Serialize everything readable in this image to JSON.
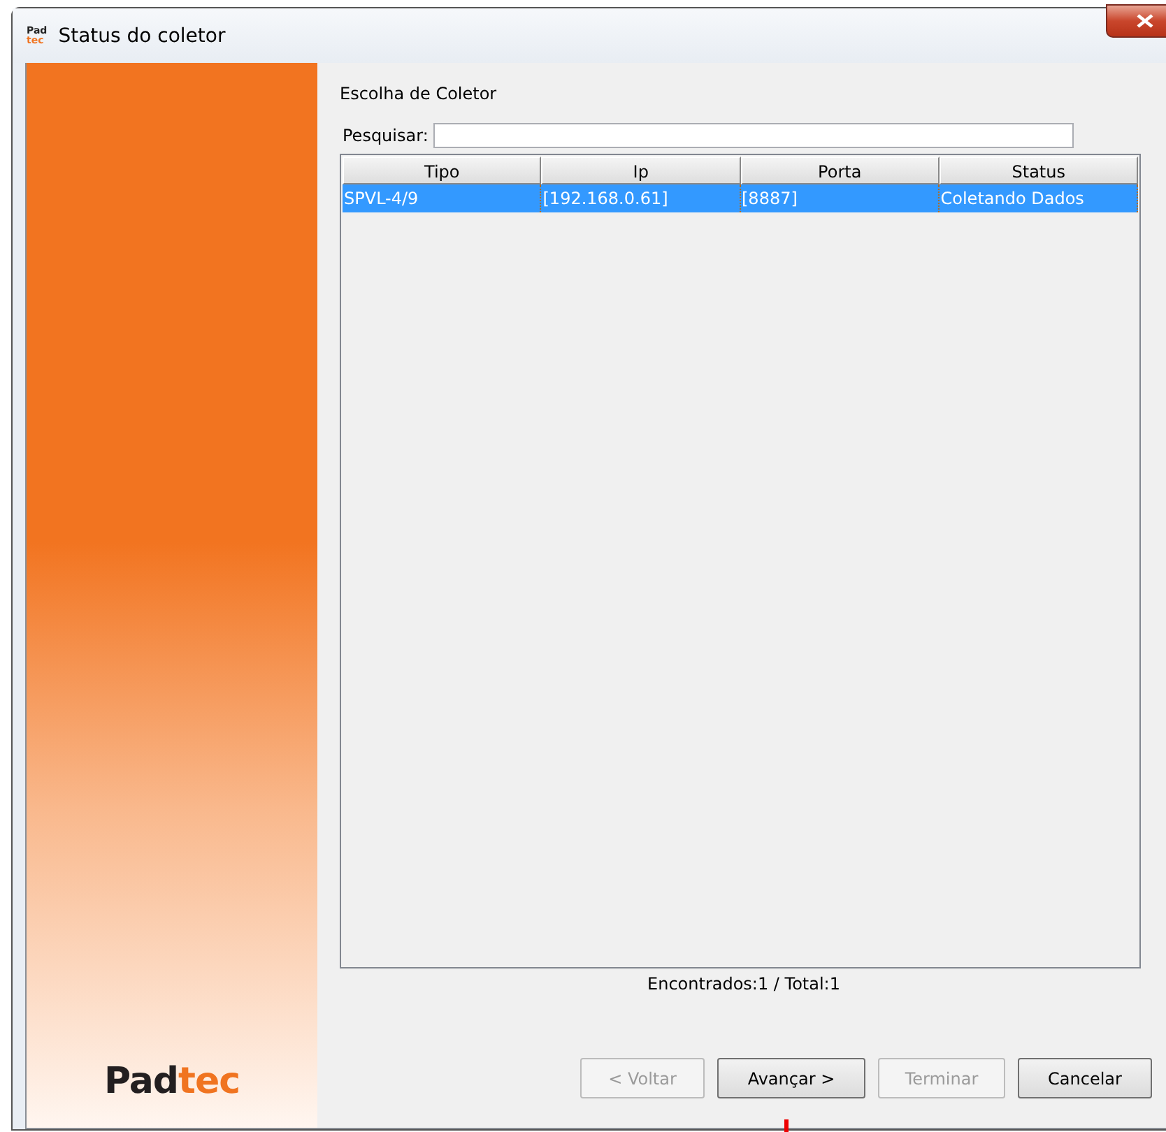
{
  "window": {
    "title": "Status do coletor",
    "icon": [
      "Pad",
      "tec"
    ]
  },
  "logo": [
    "Pad",
    "tec"
  ],
  "heading": "Escolha de Coletor",
  "search": {
    "label": "Pesquisar:"
  },
  "table": {
    "columns": [
      "Tipo",
      "Ip",
      "Porta",
      "Status"
    ],
    "rows": [
      {
        "cells": [
          "SPVL-4/9",
          "[192.168.0.61]",
          "[8887]",
          "Coletando Dados"
        ],
        "selected": true
      }
    ]
  },
  "summary": "Encontrados:1 / Total:1",
  "buttons": [
    {
      "label": "< Voltar",
      "disabled": true
    },
    {
      "label": "Avançar >",
      "disabled": false
    },
    {
      "label": "Terminar",
      "disabled": true
    },
    {
      "label": "Cancelar",
      "disabled": false
    }
  ]
}
